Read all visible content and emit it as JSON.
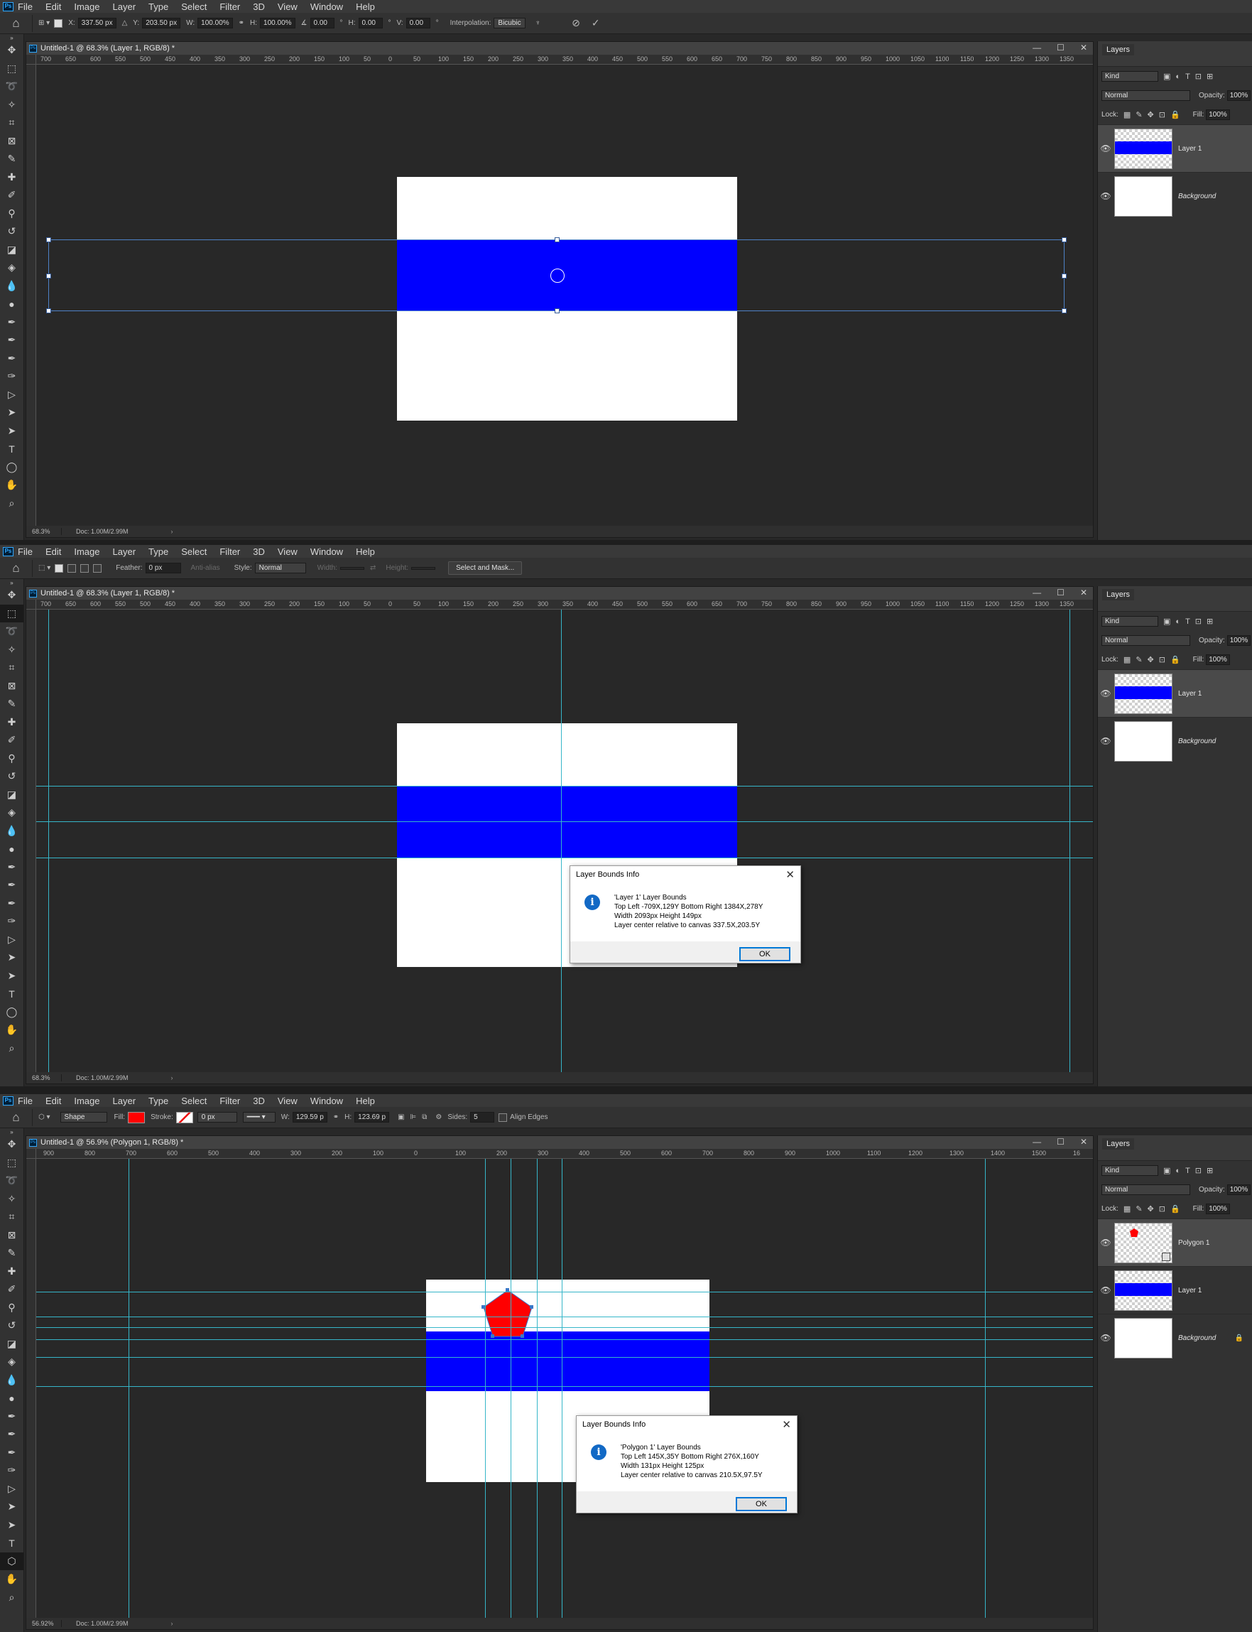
{
  "menu": [
    "File",
    "Edit",
    "Image",
    "Layer",
    "Type",
    "Select",
    "Filter",
    "3D",
    "View",
    "Window",
    "Help"
  ],
  "ps_logo": "Ps",
  "pane1": {
    "options": {
      "x_label": "X:",
      "x_value": "337.50 px",
      "y_label": "Y:",
      "y_value": "203.50 px",
      "w_label": "W:",
      "w_value": "100.00%",
      "h_label": "H:",
      "h_value": "100.00%",
      "angle_value": "0.00",
      "hskew_label": "H:",
      "hskew_value": "0.00",
      "vskew_label": "V:",
      "vskew_value": "0.00",
      "degree": "°",
      "interp_label": "Interpolation:",
      "interp_value": "Bicubic"
    },
    "doc_title": "Untitled-1 @ 68.3% (Layer 1, RGB/8) *",
    "zoom": "68.3%",
    "doc_info": "Doc: 1.00M/2.99M",
    "ruler_h": [
      "700",
      "650",
      "600",
      "550",
      "500",
      "450",
      "400",
      "350",
      "300",
      "250",
      "200",
      "150",
      "100",
      "50",
      "0",
      "50",
      "100",
      "150",
      "200",
      "250",
      "300",
      "350",
      "400",
      "450",
      "500",
      "550",
      "600",
      "650",
      "700",
      "750",
      "800",
      "850",
      "900",
      "950",
      "1000",
      "1050",
      "1100",
      "1150",
      "1200",
      "1250",
      "1300",
      "1350"
    ],
    "layers": [
      {
        "name": "Layer 1",
        "type": "band",
        "selected": true
      },
      {
        "name": "Background",
        "type": "white",
        "selected": false,
        "italic": true
      }
    ]
  },
  "pane2": {
    "options": {
      "feather_label": "Feather:",
      "feather_value": "0 px",
      "antialias": "Anti-alias",
      "style_label": "Style:",
      "style_value": "Normal",
      "width_label": "Width:",
      "height_label": "Height:",
      "select_mask": "Select and Mask..."
    },
    "doc_title": "Untitled-1 @ 68.3% (Layer 1, RGB/8) *",
    "zoom": "68.3%",
    "doc_info": "Doc: 1.00M/2.99M",
    "dialog": {
      "title": "Layer Bounds Info",
      "line1": "'Layer 1' Layer Bounds",
      "line2": "Top Left -709X,129Y   Bottom Right 1384X,278Y",
      "line3": "Width 2093px   Height 149px",
      "line4": "Layer center relative to canvas 337.5X,203.5Y",
      "ok": "OK"
    },
    "layers": [
      {
        "name": "Layer 1",
        "type": "band",
        "selected": true
      },
      {
        "name": "Background",
        "type": "white",
        "selected": false,
        "italic": true
      }
    ]
  },
  "pane3": {
    "options": {
      "mode_value": "Shape",
      "fill_label": "Fill:",
      "stroke_label": "Stroke:",
      "stroke_width": "0 px",
      "w_label": "W:",
      "w_value": "129.59 p",
      "h_label": "H:",
      "h_value": "123.69 p",
      "sides_label": "Sides:",
      "sides_value": "5",
      "align_edges": "Align Edges",
      "fill_color": "#ff0000"
    },
    "doc_title": "Untitled-1 @ 56.9% (Polygon 1, RGB/8) *",
    "zoom": "56.92%",
    "doc_info": "Doc: 1.00M/2.99M",
    "ruler_h": [
      "900",
      "800",
      "700",
      "600",
      "500",
      "400",
      "300",
      "200",
      "100",
      "0",
      "100",
      "200",
      "300",
      "400",
      "500",
      "600",
      "700",
      "800",
      "900",
      "1000",
      "1100",
      "1200",
      "1300",
      "1400",
      "1500",
      "16"
    ],
    "dialog": {
      "title": "Layer Bounds Info",
      "line1": "'Polygon 1' Layer Bounds",
      "line2": "Top Left 145X,35Y   Bottom Right 276X,160Y",
      "line3": "Width 131px   Height 125px",
      "line4": "Layer center relative to canvas 210.5X,97.5Y",
      "ok": "OK"
    },
    "layers": [
      {
        "name": "Polygon 1",
        "type": "polygon",
        "selected": true
      },
      {
        "name": "Layer 1",
        "type": "band",
        "selected": false
      },
      {
        "name": "Background",
        "type": "white",
        "selected": false,
        "italic": true,
        "locked": true
      }
    ]
  },
  "panel": {
    "tab": "Layers",
    "kind": "Kind",
    "blend": "Normal",
    "opacity_label": "Opacity:",
    "opacity": "100%",
    "lock_label": "Lock:",
    "fill_label": "Fill:",
    "fill": "100%"
  },
  "colors": {
    "accent_blue": "#0000ff",
    "guide": "#36b6c9",
    "polygon_red": "#ff0000"
  }
}
